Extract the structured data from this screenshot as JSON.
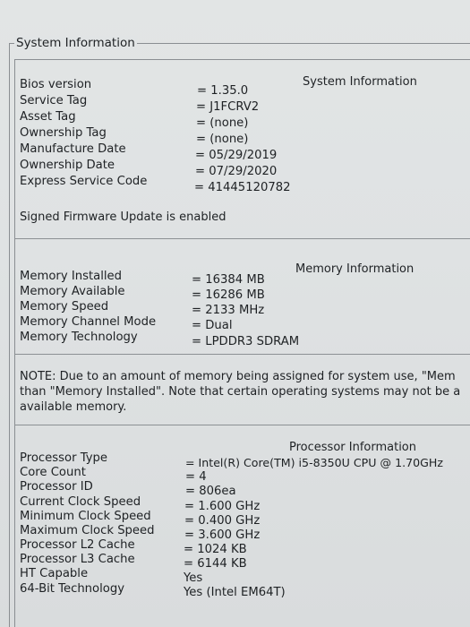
{
  "window": {
    "group_title": "System Information"
  },
  "system": {
    "title": "System Information",
    "rows": [
      {
        "label": "Bios version",
        "value": "= 1.35.0"
      },
      {
        "label": "Service Tag",
        "value": "= J1FCRV2"
      },
      {
        "label": "Asset Tag",
        "value": "= (none)"
      },
      {
        "label": "Ownership Tag",
        "value": "= (none)"
      },
      {
        "label": "Manufacture Date",
        "value": "= 05/29/2019"
      },
      {
        "label": "Ownership Date",
        "value": "= 07/29/2020"
      },
      {
        "label": "Express Service Code",
        "value": "= 41445120782"
      }
    ],
    "firmware_status": "Signed Firmware Update is enabled"
  },
  "memory": {
    "title": "Memory Information",
    "rows": [
      {
        "label": "Memory Installed",
        "value": "= 16384 MB"
      },
      {
        "label": "Memory Available",
        "value": "= 16286 MB"
      },
      {
        "label": "Memory Speed",
        "value": "= 2133 MHz"
      },
      {
        "label": "Memory Channel Mode",
        "value": "= Dual"
      },
      {
        "label": "Memory Technology",
        "value": "= LPDDR3 SDRAM"
      }
    ],
    "note_lines": [
      "NOTE: Due to an amount of memory being assigned for system use, \"Mem",
      "than \"Memory Installed\". Note that certain operating systems may not be a",
      "available memory."
    ]
  },
  "processor": {
    "title": "Processor Information",
    "rows": [
      {
        "label": "Processor Type",
        "value": "= Intel(R) Core(TM) i5-8350U CPU @ 1.70GHz"
      },
      {
        "label": "Core Count",
        "value": "= 4"
      },
      {
        "label": "Processor ID",
        "value": "= 806ea"
      },
      {
        "label": "Current Clock Speed",
        "value": "= 1.600 GHz"
      },
      {
        "label": "Minimum Clock Speed",
        "value": "= 0.400 GHz"
      },
      {
        "label": "Maximum Clock Speed",
        "value": "= 3.600 GHz"
      },
      {
        "label": "Processor L2 Cache",
        "value": "= 1024 KB"
      },
      {
        "label": "Processor L3 Cache",
        "value": "= 6144 KB"
      },
      {
        "label": "HT Capable",
        "value": "Yes"
      },
      {
        "label": "64-Bit Technology",
        "value": "Yes (Intel EM64T)"
      }
    ]
  }
}
